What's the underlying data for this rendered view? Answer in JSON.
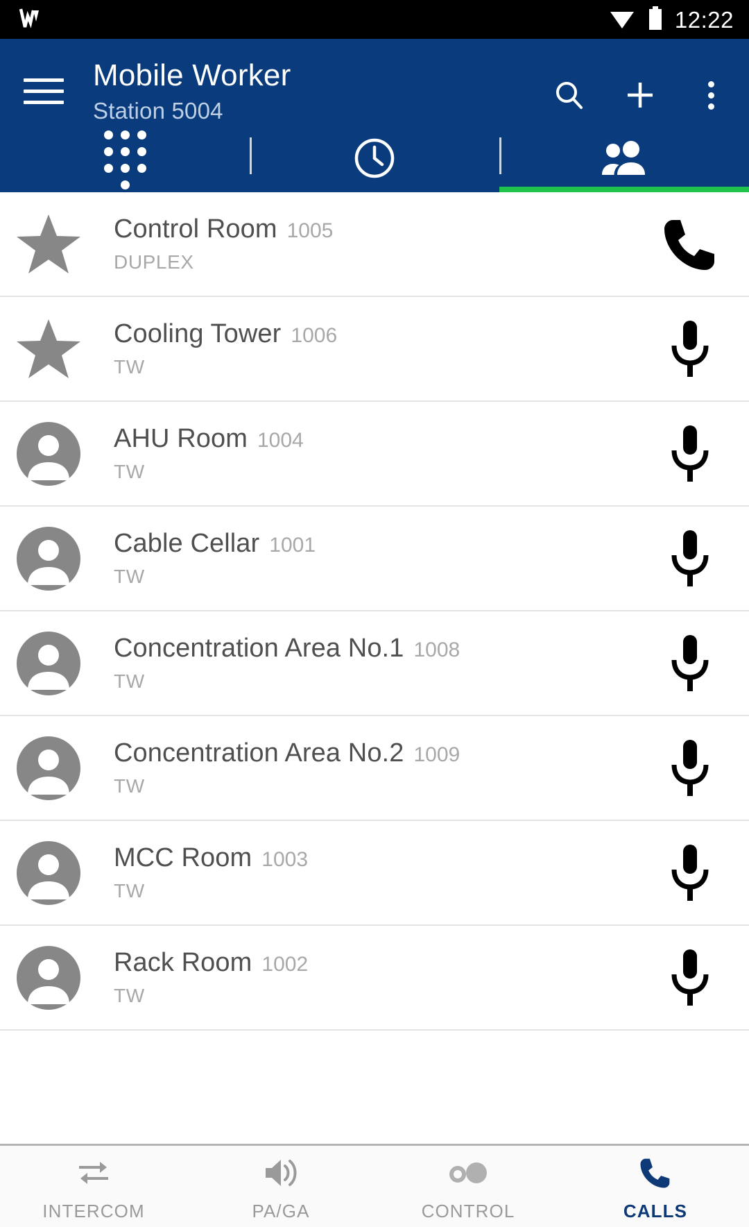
{
  "status_bar": {
    "time": "12:22",
    "icons": [
      "signal-icon",
      "wifi-icon",
      "battery-icon"
    ]
  },
  "app_bar": {
    "menu_icon": "hamburger-menu-icon",
    "title": "Mobile Worker",
    "subtitle": "Station 5004",
    "actions": [
      {
        "name": "search-icon",
        "label": "Search"
      },
      {
        "name": "add-icon",
        "label": "Add"
      },
      {
        "name": "overflow-menu-icon",
        "label": "More options"
      }
    ]
  },
  "tabs": {
    "items": [
      {
        "name": "tab-dialpad",
        "icon": "dialpad-icon",
        "active": false
      },
      {
        "name": "tab-recents",
        "icon": "clock-icon",
        "active": false
      },
      {
        "name": "tab-contacts",
        "icon": "people-icon",
        "active": true
      }
    ],
    "indicator_color": "#1fc24a"
  },
  "contacts": [
    {
      "name": "Control Room",
      "extension": "1005",
      "mode": "DUPLEX",
      "avatar": "star-icon",
      "action": "phone-icon"
    },
    {
      "name": "Cooling Tower",
      "extension": "1006",
      "mode": "TW",
      "avatar": "star-icon",
      "action": "microphone-icon"
    },
    {
      "name": "AHU Room",
      "extension": "1004",
      "mode": "TW",
      "avatar": "person-icon",
      "action": "microphone-icon"
    },
    {
      "name": "Cable Cellar",
      "extension": "1001",
      "mode": "TW",
      "avatar": "person-icon",
      "action": "microphone-icon"
    },
    {
      "name": "Concentration Area No.1",
      "extension": "1008",
      "mode": "TW",
      "avatar": "person-icon",
      "action": "microphone-icon"
    },
    {
      "name": "Concentration Area No.2",
      "extension": "1009",
      "mode": "TW",
      "avatar": "person-icon",
      "action": "microphone-icon"
    },
    {
      "name": "MCC Room",
      "extension": "1003",
      "mode": "TW",
      "avatar": "person-icon",
      "action": "microphone-icon"
    },
    {
      "name": "Rack Room",
      "extension": "1002",
      "mode": "TW",
      "avatar": "person-icon",
      "action": "microphone-icon"
    }
  ],
  "bottom_nav": {
    "items": [
      {
        "label": "INTERCOM",
        "icon": "swap-arrows-icon",
        "active": false
      },
      {
        "label": "PA/GA",
        "icon": "volume-up-icon",
        "active": false
      },
      {
        "label": "CONTROL",
        "icon": "toggle-circles-icon",
        "active": false
      },
      {
        "label": "CALLS",
        "icon": "phone-icon",
        "active": true
      }
    ],
    "active_color": "#0d3a77",
    "inactive_color": "#9a9a9a"
  },
  "colors": {
    "app_bar_blue": "#0a3c7d",
    "accent_green": "#1fc24a",
    "status_bar_black": "#000000",
    "avatar_gray": "#878787"
  }
}
